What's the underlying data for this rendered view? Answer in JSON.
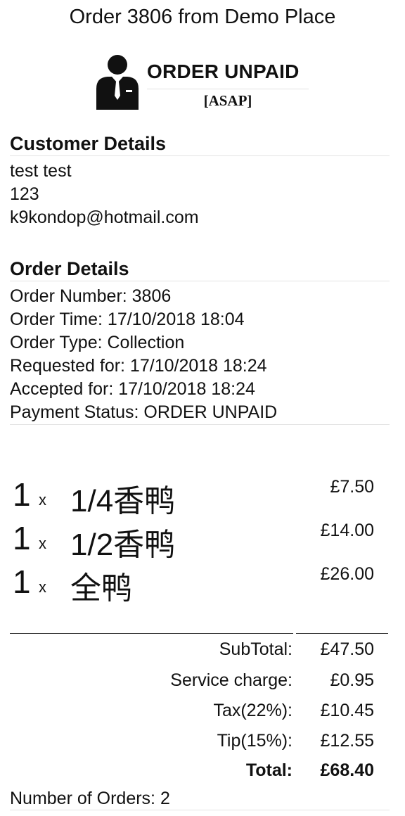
{
  "header": {
    "title": "Order 3806 from Demo Place",
    "status": "ORDER UNPAID",
    "timing": "[ASAP]",
    "avatar_icon": "person-suit-icon"
  },
  "customer": {
    "heading": "Customer Details",
    "name": "test test",
    "phone": "123",
    "email": "k9kondop@hotmail.com"
  },
  "order": {
    "heading": "Order Details",
    "number": "Order Number: 3806",
    "time": "Order Time: 17/10/2018 18:04",
    "type": "Order Type: Collection",
    "requested": "Requested for:  17/10/2018 18:24",
    "accepted": "Accepted for: 17/10/2018 18:24",
    "payment": "Payment Status: ORDER UNPAID"
  },
  "items": [
    {
      "qty": "1",
      "x": "x",
      "name": "1/4香鸭",
      "price": "£7.50"
    },
    {
      "qty": "1",
      "x": "x",
      "name": "1/2香鸭",
      "price": "£14.00"
    },
    {
      "qty": "1",
      "x": "x",
      "name": "全鸭",
      "price": "£26.00"
    }
  ],
  "totals": {
    "subtotal_label": "SubTotal:",
    "subtotal": "£47.50",
    "service_label": "Service charge:",
    "service": "£0.95",
    "tax_label": "Tax(22%):",
    "tax": "£10.45",
    "tip_label": "Tip(15%):",
    "tip": "£12.55",
    "total_label": "Total:",
    "total": "£68.40"
  },
  "footer": {
    "orders_count": "Number of Orders: 2"
  }
}
